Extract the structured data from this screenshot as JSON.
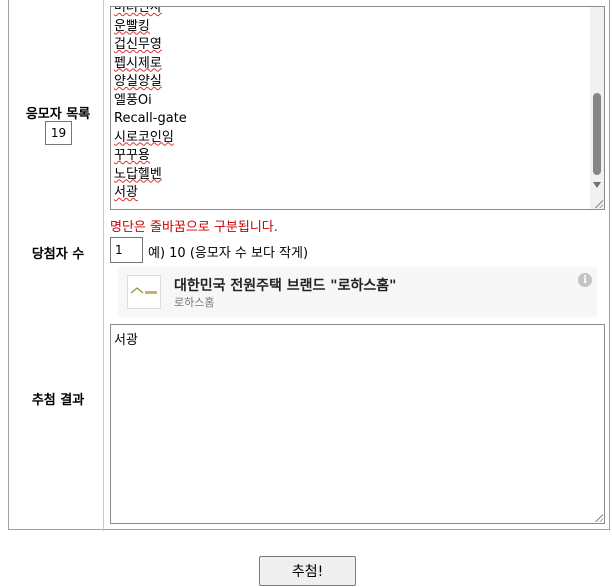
{
  "labels": {
    "entrant_list": "응모자 목록",
    "winner_count": "당첨자 수",
    "draw_result": "추첨 결과"
  },
  "entrant_count": "19",
  "entrants": [
    {
      "text": "버려신사",
      "spell_flag": true
    },
    {
      "text": "운빨킹",
      "spell_flag": true
    },
    {
      "text": "겁신무영",
      "spell_flag": true
    },
    {
      "text": "펩시제로",
      "spell_flag": true
    },
    {
      "text": "양실양실",
      "spell_flag": true
    },
    {
      "text": "엘풍Oi",
      "spell_flag": false
    },
    {
      "text": "Recall-gate",
      "spell_flag": false
    },
    {
      "text": "시로코인임",
      "spell_flag": true
    },
    {
      "text": "꾸꾸용",
      "spell_flag": true
    },
    {
      "text": "노답헬벤",
      "spell_flag": true
    },
    {
      "text": "서광",
      "spell_flag": true
    }
  ],
  "hint": "명단은 줄바꿈으로 구분됩니다.",
  "winner_input_value": "1",
  "winner_example": "예) 10 (응모자 수 보다 작게)",
  "ad": {
    "title": "대한민국 전원주택 브랜드 \"로하스홈\"",
    "subtitle": "로하스홈",
    "logo_text": "로하스홈",
    "info_glyph": "i"
  },
  "result_text": "서광",
  "draw_button": "추첨!",
  "colors": {
    "hint": "#cc0000",
    "spell_underline": "#e03030"
  }
}
